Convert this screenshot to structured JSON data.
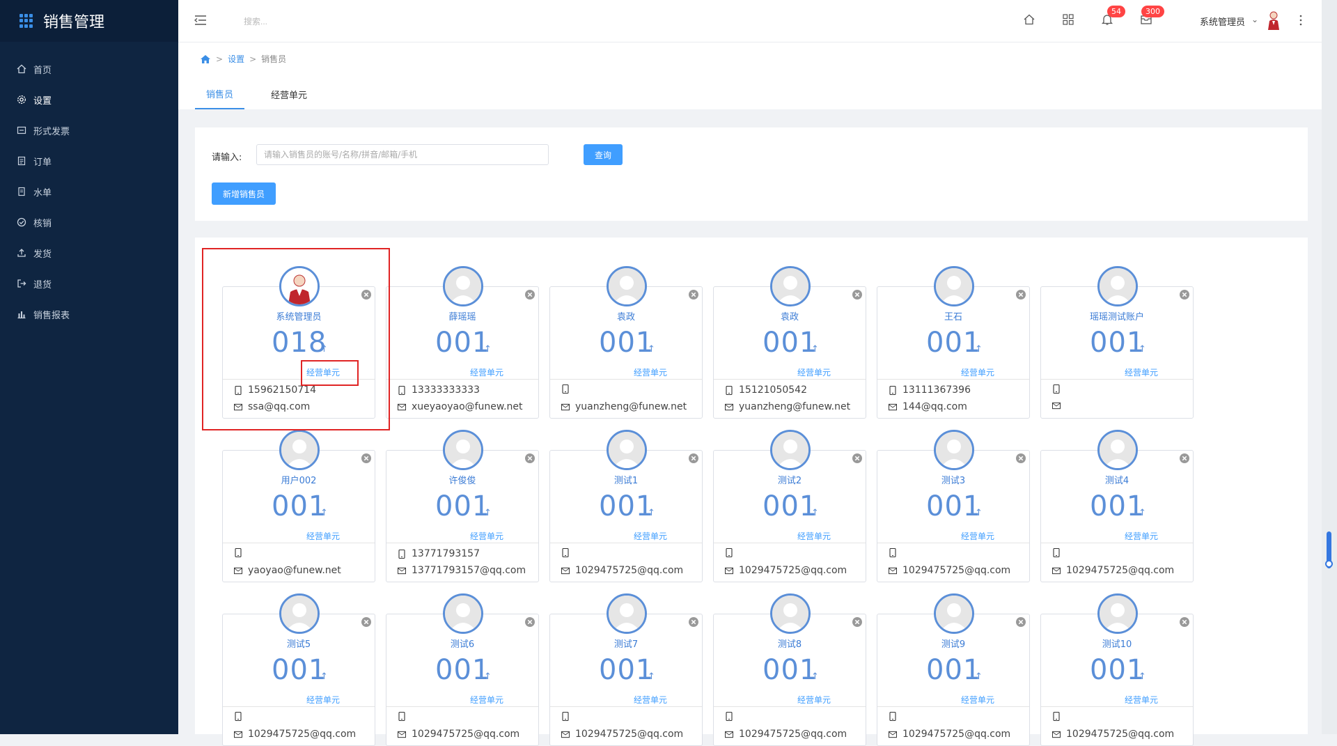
{
  "app": {
    "title": "销售管理"
  },
  "sidebar": {
    "items": [
      {
        "label": "首页",
        "icon": "home-icon"
      },
      {
        "label": "设置",
        "icon": "gear-icon"
      },
      {
        "label": "形式发票",
        "icon": "invoice-icon"
      },
      {
        "label": "订单",
        "icon": "order-icon"
      },
      {
        "label": "水单",
        "icon": "receipt-icon"
      },
      {
        "label": "核销",
        "icon": "check-circle-icon"
      },
      {
        "label": "发货",
        "icon": "upload-icon"
      },
      {
        "label": "退货",
        "icon": "logout-icon"
      },
      {
        "label": "销售报表",
        "icon": "bar-chart-icon"
      }
    ]
  },
  "header": {
    "search_placeholder": "搜索...",
    "notification_count": "54",
    "message_count": "300",
    "user_name": "系统管理员"
  },
  "breadcrumb": {
    "home_icon": "home-icon",
    "parent": "设置",
    "current": "销售员"
  },
  "tabs": [
    {
      "label": "销售员"
    },
    {
      "label": "经营单元"
    }
  ],
  "filter": {
    "label": "请输入:",
    "placeholder": "请输入销售员的账号/名称/拼音/邮箱/手机",
    "query_label": "查询",
    "add_label": "新增销售员"
  },
  "cards": [
    {
      "name": "系统管理员",
      "count": "018",
      "unit": "经营单元",
      "phone": "15962150714",
      "email": "ssa@qq.com",
      "avatar": "admin-avatar"
    },
    {
      "name": "薛瑶瑶",
      "count": "001",
      "unit": "经营单元",
      "phone": "13333333333",
      "email": "xueyaoyao@funew.net"
    },
    {
      "name": "袁政",
      "count": "001",
      "unit": "经营单元",
      "phone": "",
      "email": "yuanzheng@funew.net"
    },
    {
      "name": "袁政",
      "count": "001",
      "unit": "经营单元",
      "phone": "15121050542",
      "email": "yuanzheng@funew.net"
    },
    {
      "name": "王石",
      "count": "001",
      "unit": "经营单元",
      "phone": "13111367396",
      "email": "144@qq.com"
    },
    {
      "name": "瑶瑶测试账户",
      "count": "001",
      "unit": "经营单元",
      "phone": "",
      "email": ""
    },
    {
      "name": "用户002",
      "count": "001",
      "unit": "经营单元",
      "phone": "",
      "email": "yaoyao@funew.net"
    },
    {
      "name": "许俊俊",
      "count": "001",
      "unit": "经营单元",
      "phone": "13771793157",
      "email": "13771793157@qq.com"
    },
    {
      "name": "测试1",
      "count": "001",
      "unit": "经营单元",
      "phone": "",
      "email": "1029475725@qq.com"
    },
    {
      "name": "测试2",
      "count": "001",
      "unit": "经营单元",
      "phone": "",
      "email": "1029475725@qq.com"
    },
    {
      "name": "测试3",
      "count": "001",
      "unit": "经营单元",
      "phone": "",
      "email": "1029475725@qq.com"
    },
    {
      "name": "测试4",
      "count": "001",
      "unit": "经营单元",
      "phone": "",
      "email": "1029475725@qq.com"
    },
    {
      "name": "测试5",
      "count": "001",
      "unit": "经营单元",
      "phone": "",
      "email": "1029475725@qq.com"
    },
    {
      "name": "测试6",
      "count": "001",
      "unit": "经营单元",
      "phone": "",
      "email": "1029475725@qq.com"
    },
    {
      "name": "测试7",
      "count": "001",
      "unit": "经营单元",
      "phone": "",
      "email": "1029475725@qq.com"
    },
    {
      "name": "测试8",
      "count": "001",
      "unit": "经营单元",
      "phone": "",
      "email": "1029475725@qq.com"
    },
    {
      "name": "测试9",
      "count": "001",
      "unit": "经营单元",
      "phone": "",
      "email": "1029475725@qq.com"
    },
    {
      "name": "测试10",
      "count": "001",
      "unit": "经营单元",
      "phone": "",
      "email": "1029475725@qq.com"
    }
  ],
  "colors": {
    "sidebar_bg": "#0f2541",
    "accent": "#409eff",
    "badge": "#ff4444",
    "highlight": "#e02424"
  }
}
